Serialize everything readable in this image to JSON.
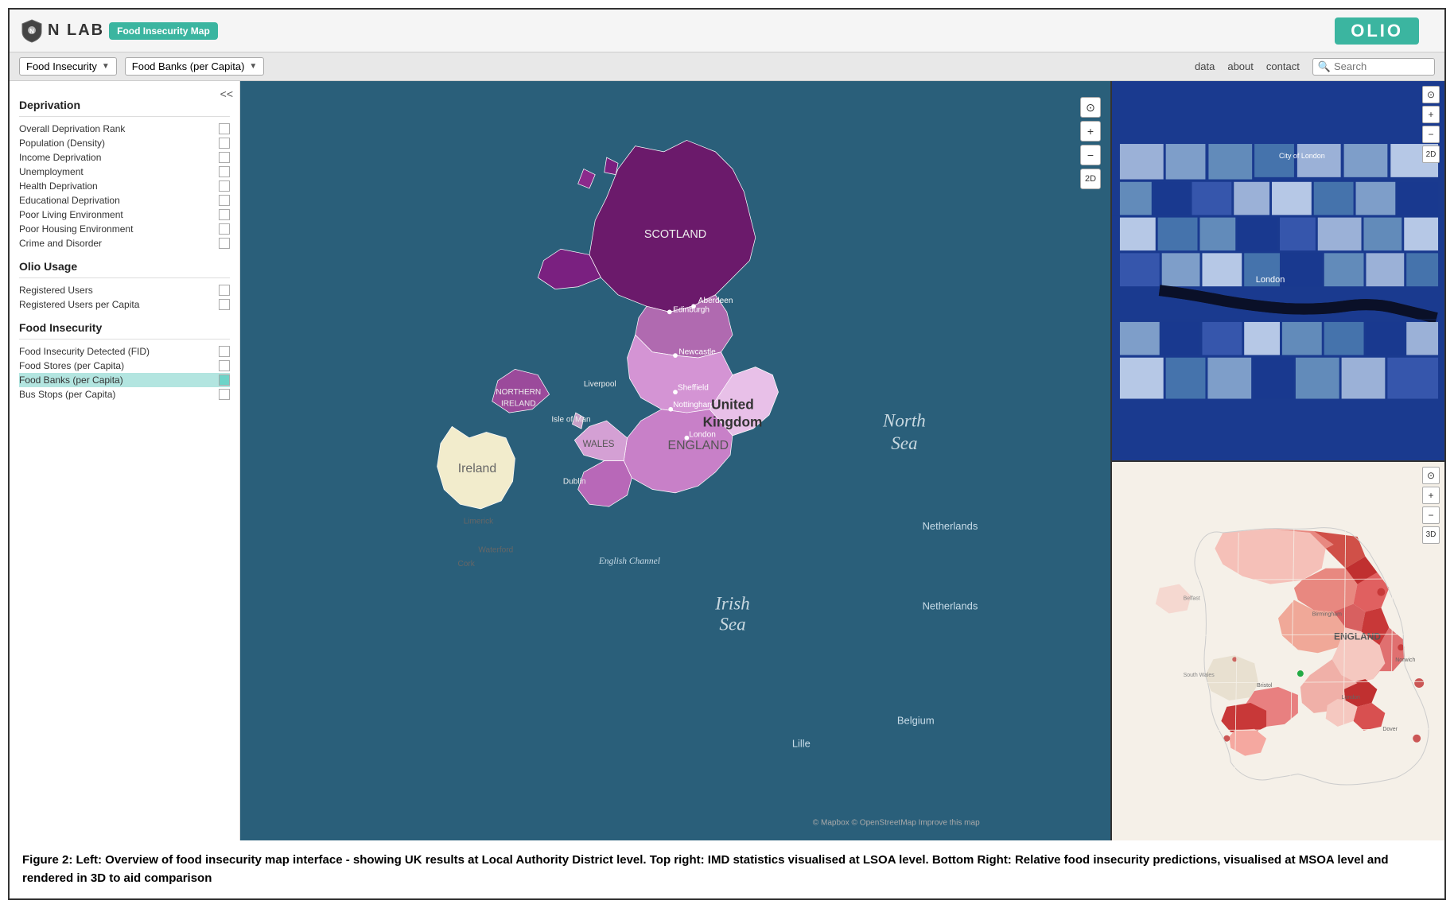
{
  "nav": {
    "logo_text": "N LAB",
    "badge_label": "Food Insecurity Map",
    "olio_label": "OLIO",
    "dropdown1_label": "Food Insecurity",
    "dropdown2_label": "Food Banks (per Capita)",
    "nav_link_data": "data",
    "nav_link_about": "about",
    "nav_link_contact": "contact",
    "search_placeholder": "Search",
    "collapse_label": "<<"
  },
  "sidebar": {
    "section_deprivation": "Deprivation",
    "items_deprivation": [
      "Overall Deprivation Rank",
      "Population (Density)",
      "Income Deprivation",
      "Unemployment",
      "Health Deprivation",
      "Educational Deprivation",
      "Poor Living Environment",
      "Poor Housing Environment",
      "Crime and Disorder"
    ],
    "section_olio": "Olio Usage",
    "items_olio": [
      "Registered Users",
      "Registered Users per Capita"
    ],
    "section_food": "Food Insecurity",
    "items_food": [
      "Food Insecurity Detected (FID)",
      "Food Stores (per Capita)",
      "Food Banks (per Capita)",
      "Bus Stops (per Capita)"
    ],
    "active_item": "Food Banks (per Capita)"
  },
  "map": {
    "sea_label_north": "North\nSea",
    "sea_label_irish": "Irish\nSea",
    "country_uk": "United\nKingdom",
    "country_ireland": "Ireland",
    "country_scotland": "SCOTLAND",
    "country_northern_ireland": "NORTHERN\nIRELAND",
    "country_wales": "WALES",
    "country_england": "ENGLAND",
    "country_netherlands": "Netherlands",
    "country_belgium": "Belgium",
    "controls": {
      "locate": "⊙",
      "zoom_in": "+",
      "zoom_out": "−",
      "mode_2d": "2D"
    }
  },
  "mini_map_top": {
    "city_label": "City of London",
    "place_london": "London",
    "controls": {
      "locate": "⊙",
      "zoom_in": "+",
      "zoom_out": "−",
      "mode_2d": "2D"
    }
  },
  "mini_map_bottom": {
    "region_label": "ENGLAND",
    "controls": {
      "locate": "⊙",
      "zoom_in": "+",
      "zoom_out": "−",
      "mode_3d": "3D"
    }
  },
  "caption": {
    "text": "Figure 2: Left: Overview of food insecurity map interface - showing UK results at Local Authority District level. Top right: IMD statistics visualised at LSOA level. Bottom Right: Relative food insecurity predictions, visualised at MSOA level and rendered in 3D to aid comparison"
  },
  "colors": {
    "teal": "#3bb5a0",
    "dark_sea": "#2a5f7a",
    "map_purple_light": "#e8c8e8",
    "map_purple_mid": "#c87cc8",
    "map_purple_dark": "#8b258b",
    "map_beige": "#f5f0d8",
    "blue_dark": "#1a3a8f",
    "blue_light": "#aabfdf",
    "red_dark": "#c0302a",
    "red_light": "#f5c0b8"
  }
}
